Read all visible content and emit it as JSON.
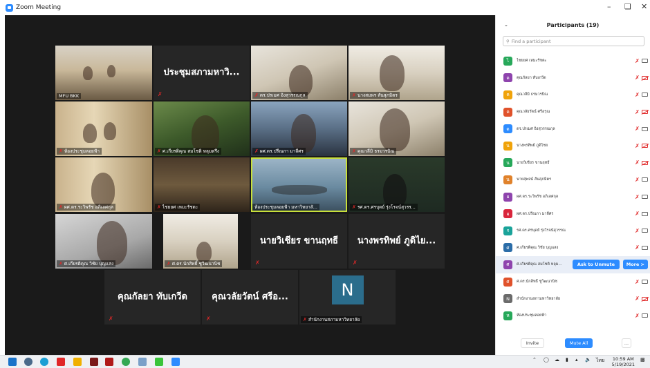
{
  "window": {
    "title": "Zoom Meeting"
  },
  "video_tiles": [
    {
      "id": "t1",
      "label": "MFU BKK",
      "type": "video"
    },
    {
      "id": "t2",
      "display_name": "ประชุมสภามหาวิ...",
      "type": "name"
    },
    {
      "id": "t3",
      "label": "ดร.ปรเมศ อิงสุวรรณกุล",
      "type": "video"
    },
    {
      "id": "t4",
      "label": "นางสมพร สันสุภมิตร",
      "type": "video"
    },
    {
      "id": "t5",
      "label": "ห้องประชุมลอยฟ้า",
      "type": "video"
    },
    {
      "id": "t6",
      "label": "ศ.เกียรติคุณ สมโชติ หลุมตรึง",
      "type": "video"
    },
    {
      "id": "t7",
      "label": "ผศ.ดร.ปรีณภา มาลีศร",
      "type": "video"
    },
    {
      "id": "t8",
      "label": "คุณวลีมิ ธรมวรบิณ",
      "type": "video"
    },
    {
      "id": "t9",
      "label": "ผศ.ดร.ระวิพรัช อภิเลศกุล",
      "type": "video"
    },
    {
      "id": "t10",
      "label": "ไชยยศ เหมะรัชตะ",
      "type": "video"
    },
    {
      "id": "t11",
      "label": "ห้องประชุมลอยฟ้า มหาวิทยาลั...",
      "type": "video",
      "active": true
    },
    {
      "id": "t12",
      "label": "รศ.ดร.ศรบุดย์ รุ่งโรจน์สุวรร...",
      "type": "video"
    },
    {
      "id": "t13",
      "label": "ศ.เกียรติคุณ วิชัย บุญแสง",
      "type": "video"
    },
    {
      "id": "t14",
      "label": "ศ.ดร.นักสิทธิ์ ชูวิฒนานิช",
      "type": "video"
    },
    {
      "id": "t15",
      "display_name": "นายวิเชียร ขานฤทธี",
      "type": "name"
    },
    {
      "id": "t16",
      "display_name": "นางพรทิพย์ ภูดิไย...",
      "type": "name"
    },
    {
      "id": "t17",
      "display_name": "คุณกัลยา ทับเกวีด",
      "type": "name"
    },
    {
      "id": "t18",
      "display_name": "คุณวลัยวัตน์ ศรีอ...",
      "type": "name"
    },
    {
      "id": "t19",
      "avatar_letter": "N",
      "label": "สำนักงานสภามหาวิทยาลัย",
      "type": "avatar"
    }
  ],
  "participants_panel": {
    "title": "Participants (19)",
    "search_placeholder": "Find a participant",
    "participants": [
      {
        "initial": "ไ",
        "name": "ไชยยศ เหมะรัชตะ",
        "color": "#27a85a",
        "cam_off": false
      },
      {
        "initial": "ค",
        "name": "คุณกัลยา ทับเกวีด",
        "color": "#8e44ad",
        "cam_off": true
      },
      {
        "initial": "ค",
        "name": "คุณวลีมิ ธรมวรบิณ",
        "color": "#f0a30a",
        "cam_off": false
      },
      {
        "initial": "ค",
        "name": "คุณวลัยรัตน์ ศรีอรุณ",
        "color": "#e0522b",
        "cam_off": true
      },
      {
        "initial": "ด",
        "name": "ดร.ปรเมศ อิงสุวรรณกุล",
        "color": "#2d8cff",
        "cam_off": false
      },
      {
        "initial": "น",
        "name": "นางพรทิพย์ ภูดิไชย",
        "color": "#f0a30a",
        "cam_off": true
      },
      {
        "initial": "น",
        "name": "นายวิเชียร ขานฤทธี",
        "color": "#27a85a",
        "cam_off": true
      },
      {
        "initial": "น",
        "name": "นายสุพจน์ สันสุภมิตร",
        "color": "#e0822b",
        "cam_off": false
      },
      {
        "initial": "ผ",
        "name": "ผศ.ดร.ระวิพรัช อภิเลศกุล",
        "color": "#8e44ad",
        "cam_off": false
      },
      {
        "initial": "ผ",
        "name": "ผศ.ดร.ปรีณภา มาลีศร",
        "color": "#d9263c",
        "cam_off": false
      },
      {
        "initial": "ร",
        "name": "รศ.ดร.ศรบุดย์ รุ่งโรจน์สุวรรณ",
        "color": "#1aa39a",
        "cam_off": false
      },
      {
        "initial": "ศ",
        "name": "ศ.เกียรติคุณ วิชัย บุญแสง",
        "color": "#2b6da8",
        "cam_off": false
      },
      {
        "initial": "ศ",
        "name": "ศ.เกียรติคุณ สมโชติ หลุม...",
        "color": "#8e44ad",
        "cam_off": false,
        "hovered": true
      },
      {
        "initial": "ศ",
        "name": "ศ.ดร.นักสิทธิ์ ชูวิฒนานิช",
        "color": "#e0522b",
        "cam_off": false
      },
      {
        "initial": "N",
        "name": "สำนักงานสภามหาวิทยาลัย",
        "color": "#6b6b6b",
        "cam_off": true
      },
      {
        "initial": "ห",
        "name": "ห้องประชุมลอยฟ้า",
        "color": "#27a85a",
        "cam_off": false
      }
    ],
    "hover_actions": {
      "ask_to_unmute": "Ask to Unmute",
      "more": "More >"
    },
    "footer": {
      "invite": "Invite",
      "mute_all": "Mute All",
      "more": "..."
    }
  },
  "taskbar": {
    "time": "10:59 AM",
    "date": "5/19/2021",
    "lang": "ไทย"
  }
}
